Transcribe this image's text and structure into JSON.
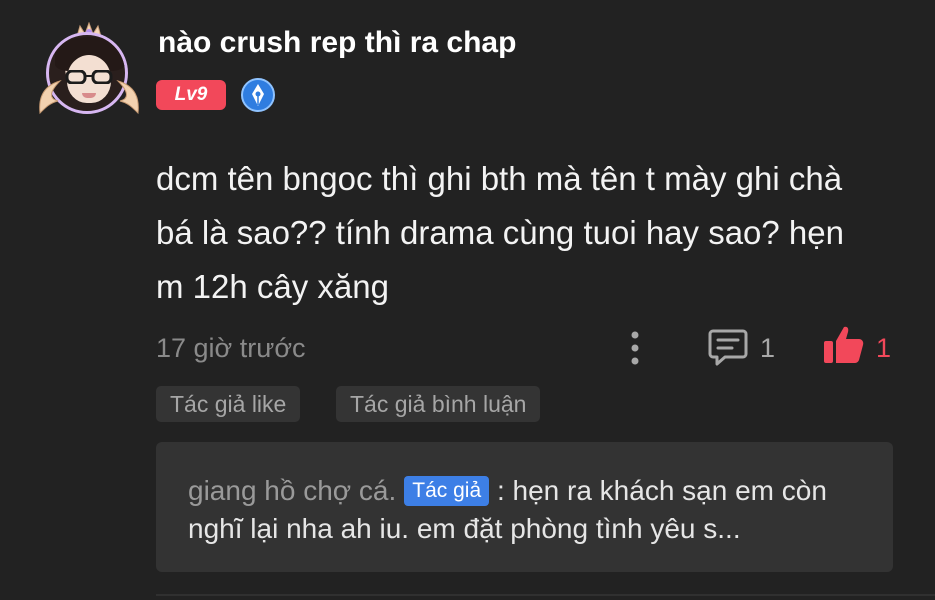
{
  "comment": {
    "username": "nào crush rep thì ra chap",
    "level": "Lv9",
    "text": "dcm tên bngoc thì ghi bth mà tên t mày ghi chà bá là sao?? tính drama cùng tuoi hay sao? hẹn m 12h cây xăng",
    "timestamp": "17 giờ trước",
    "reply_count": "1",
    "like_count": "1",
    "tags": [
      "Tác giả like",
      "Tác giả bình luận"
    ]
  },
  "reply_preview": {
    "author": "giang hồ chợ cá.",
    "author_badge": "Tác giả",
    "separator": ":",
    "text": "hẹn ra khách sạn em còn nghĩ lại nha ah iu. em đặt phòng tình yêu s..."
  },
  "icons": {
    "more": "more-vertical-icon",
    "reply": "comment-icon",
    "like": "thumbs-up-icon",
    "verified": "pen-badge-icon"
  },
  "colors": {
    "background": "#222222",
    "accent": "#f2485a",
    "author_badge": "#3d7fe6",
    "muted": "#8a8a8a"
  }
}
